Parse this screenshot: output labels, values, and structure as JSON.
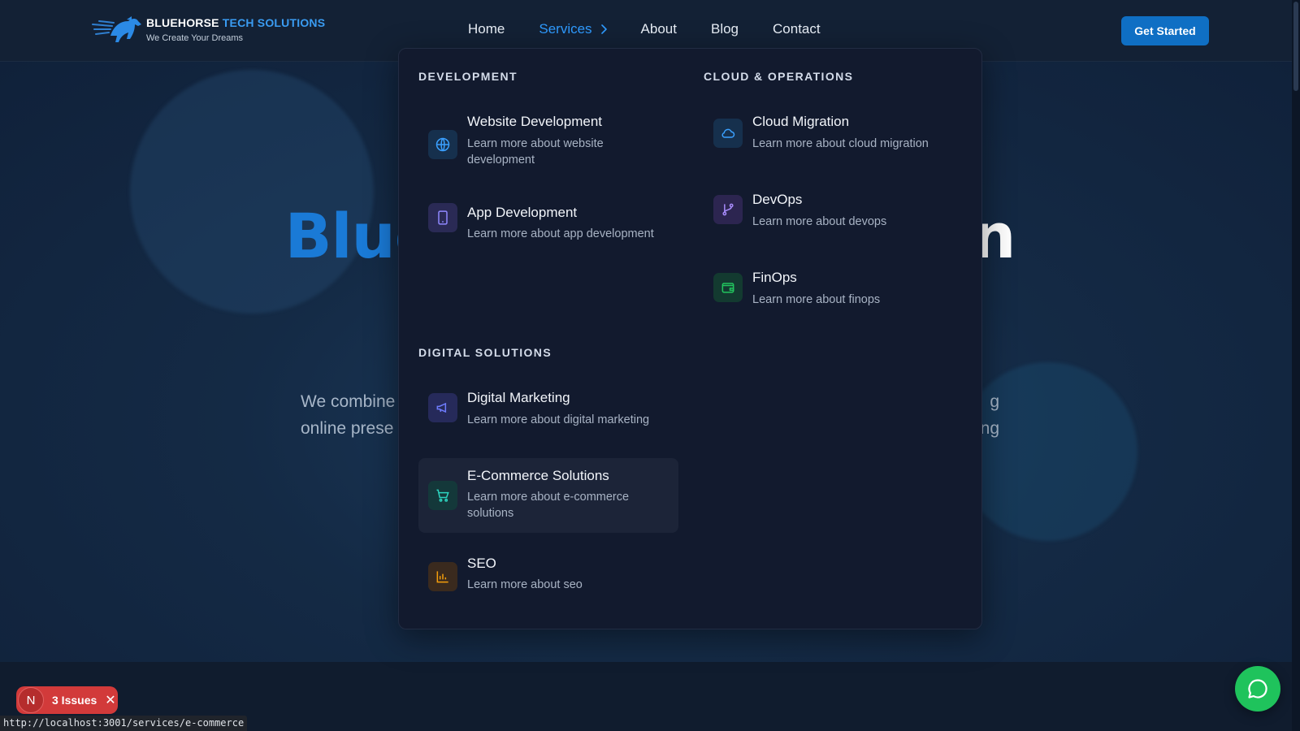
{
  "header": {
    "brand_name_part1": "BLUEHORSE ",
    "brand_name_part2": "TECH SOLUTIONS",
    "brand_tagline": "We Create Your Dreams",
    "nav": [
      {
        "label": "Home",
        "active": false
      },
      {
        "label": "Services",
        "active": true
      },
      {
        "label": "About",
        "active": false
      },
      {
        "label": "Blog",
        "active": false
      },
      {
        "label": "Contact",
        "active": false
      }
    ],
    "cta_label": "Get Started"
  },
  "hero": {
    "title_left": "Blue",
    "title_right": "n",
    "subtitle_line1_left": "We combine",
    "subtitle_line1_right": "g",
    "subtitle_line2_left": "online prese",
    "subtitle_line2_right": "ng"
  },
  "mega_menu": {
    "sections": [
      {
        "heading": "DEVELOPMENT",
        "items": [
          {
            "title": "Website Development",
            "description": "Learn more about website development",
            "icon": "globe-icon",
            "icon_bg": "#16304d",
            "icon_color": "#3aa0ff"
          },
          {
            "title": "App Development",
            "description": "Learn more about app development",
            "icon": "phone-icon",
            "icon_bg": "#2a2a55",
            "icon_color": "#8f88ff"
          }
        ]
      },
      {
        "heading": "CLOUD & OPERATIONS",
        "items": [
          {
            "title": "Cloud Migration",
            "description": "Learn more about cloud migration",
            "icon": "cloud-icon",
            "icon_bg": "#16304d",
            "icon_color": "#3aa0ff"
          },
          {
            "title": "DevOps",
            "description": "Learn more about devops",
            "icon": "git-branch-icon",
            "icon_bg": "#2c2550",
            "icon_color": "#a78bfa"
          },
          {
            "title": "FinOps",
            "description": "Learn more about finops",
            "icon": "wallet-icon",
            "icon_bg": "#133a30",
            "icon_color": "#22c55e"
          }
        ]
      },
      {
        "heading": "DIGITAL SOLUTIONS",
        "items": [
          {
            "title": "Digital Marketing",
            "description": "Learn more about digital marketing",
            "icon": "megaphone-icon",
            "icon_bg": "#262a5a",
            "icon_color": "#6f7dff"
          },
          {
            "title": "E-Commerce Solutions",
            "description": "Learn more about e-commerce solutions",
            "icon": "cart-icon",
            "icon_bg": "#14383a",
            "icon_color": "#2dd4bf"
          },
          {
            "title": "SEO",
            "description": "Learn more about seo",
            "icon": "bar-chart-icon",
            "icon_bg": "#3a2a1e",
            "icon_color": "#f59e0b"
          }
        ]
      }
    ]
  },
  "widgets": {
    "issues_badge_letter": "N",
    "issues_label": "3 Issues",
    "status_url": "http://localhost:3001/services/e-commerce"
  },
  "colors": {
    "accent": "#2f9bff",
    "cta_bg": "#0f6fc4",
    "chat_bg": "#1fc35c",
    "issues_bg": "#d23a3a"
  }
}
